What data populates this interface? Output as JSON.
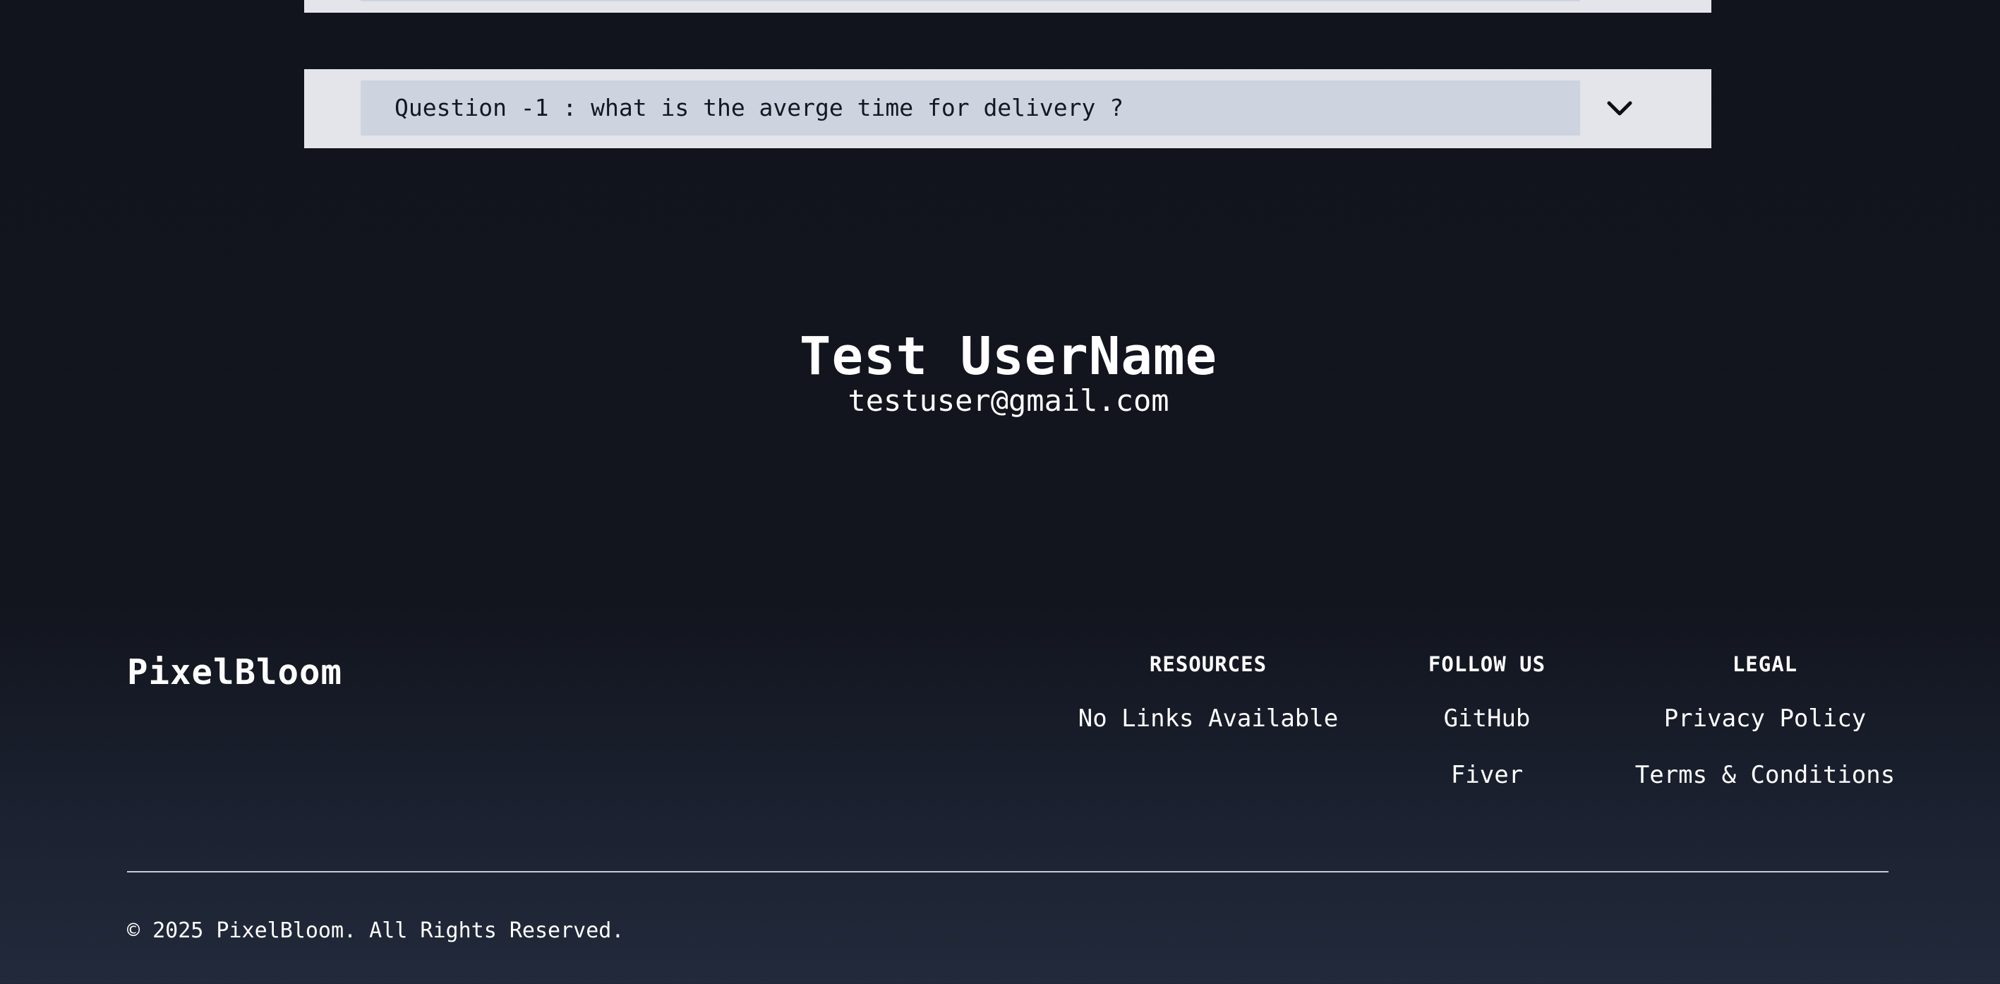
{
  "faq": {
    "items": [
      {
        "question": "Question -1 : what is the averge time for delivery ?"
      }
    ],
    "expand_icon": "chevron-down-icon"
  },
  "profile": {
    "name": "Test UserName",
    "email": "testuser@gmail.com"
  },
  "footer": {
    "brand": "PixelBloom",
    "resources": {
      "heading": "RESOURCES",
      "empty_text": "No Links Available"
    },
    "follow_us": {
      "heading": "FOLLOW US",
      "links": [
        "GitHub",
        "Fiver"
      ]
    },
    "legal": {
      "heading": "LEGAL",
      "links": [
        "Privacy Policy",
        "Terms & Conditions"
      ]
    },
    "copyright": "© 2025 PixelBloom. All Rights Reserved."
  },
  "colors": {
    "background": "#11141d",
    "faq_panel": "#e3e5ea",
    "faq_question_bg": "#cdd4df",
    "text": "#ffffff"
  }
}
